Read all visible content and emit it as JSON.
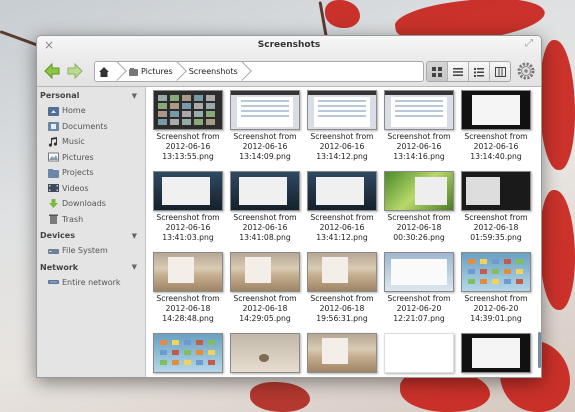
{
  "window": {
    "title": "Screenshots",
    "close_glyph": "×",
    "maximize_glyph": "⤢"
  },
  "toolbar": {
    "back_icon": "back-arrow-icon",
    "forward_icon": "forward-arrow-icon",
    "breadcrumbs": [
      {
        "label": "",
        "icon": "home-icon"
      },
      {
        "label": "Pictures",
        "icon": "pictures-folder-icon"
      },
      {
        "label": "Screenshots",
        "icon": ""
      }
    ],
    "view_modes": [
      "icon-view",
      "list-view",
      "compact-view",
      "column-view"
    ],
    "active_view": "icon-view"
  },
  "sidebar": {
    "sections": [
      {
        "title": "Personal",
        "items": [
          {
            "label": "Home",
            "icon": "home-folder-icon"
          },
          {
            "label": "Documents",
            "icon": "documents-folder-icon"
          },
          {
            "label": "Music",
            "icon": "music-icon"
          },
          {
            "label": "Pictures",
            "icon": "pictures-icon"
          },
          {
            "label": "Projects",
            "icon": "projects-folder-icon"
          },
          {
            "label": "Videos",
            "icon": "videos-icon"
          },
          {
            "label": "Downloads",
            "icon": "downloads-icon"
          },
          {
            "label": "Trash",
            "icon": "trash-icon"
          }
        ]
      },
      {
        "title": "Devices",
        "items": [
          {
            "label": "File System",
            "icon": "drive-icon"
          }
        ]
      },
      {
        "title": "Network",
        "items": [
          {
            "label": "Entire network",
            "icon": "network-icon"
          }
        ]
      }
    ]
  },
  "files": [
    {
      "name": [
        "Screenshot from",
        "2012-06-16",
        "13:13:55.png"
      ],
      "thumb": "dark"
    },
    {
      "name": [
        "Screenshot from",
        "2012-06-16",
        "13:14:09.png"
      ],
      "thumb": "doc"
    },
    {
      "name": [
        "Screenshot from",
        "2012-06-16",
        "13:14:12.png"
      ],
      "thumb": "doc"
    },
    {
      "name": [
        "Screenshot from",
        "2012-06-16",
        "13:14:16.png"
      ],
      "thumb": "doc"
    },
    {
      "name": [
        "Screenshot from",
        "2012-06-16",
        "13:14:40.png"
      ],
      "thumb": "term"
    },
    {
      "name": [
        "Screenshot from",
        "2012-06-16",
        "13:41:03.png"
      ],
      "thumb": "blue"
    },
    {
      "name": [
        "Screenshot from",
        "2012-06-16",
        "13:41:08.png"
      ],
      "thumb": "blue"
    },
    {
      "name": [
        "Screenshot from",
        "2012-06-16",
        "13:41:12.png"
      ],
      "thumb": "blue"
    },
    {
      "name": [
        "Screenshot from",
        "2012-06-18",
        "00:30:26.png"
      ],
      "thumb": "green"
    },
    {
      "name": [
        "Screenshot from",
        "2012-06-18",
        "01:59:35.png"
      ],
      "thumb": "black2"
    },
    {
      "name": [
        "Screenshot from",
        "2012-06-18",
        "14:28:48.png"
      ],
      "thumb": "dune"
    },
    {
      "name": [
        "Screenshot from",
        "2012-06-18",
        "14:29:05.png"
      ],
      "thumb": "dune"
    },
    {
      "name": [
        "Screenshot from",
        "2012-06-18",
        "19:56:31.png"
      ],
      "thumb": "dune"
    },
    {
      "name": [
        "Screenshot from",
        "2012-06-20",
        "12:21:07.png"
      ],
      "thumb": "desk"
    },
    {
      "name": [
        "Screenshot from",
        "2012-06-20",
        "14:39:01.png"
      ],
      "thumb": "icons"
    },
    {
      "name": [],
      "thumb": "icons"
    },
    {
      "name": [],
      "thumb": "shell"
    },
    {
      "name": [],
      "thumb": "dune"
    },
    {
      "name": [],
      "thumb": "white"
    },
    {
      "name": [],
      "thumb": "term"
    }
  ],
  "colors": {
    "accent": "#3d7bb8",
    "sidebar_bg": "#e4e4e4",
    "nav_arrow": "#8cc63f"
  }
}
